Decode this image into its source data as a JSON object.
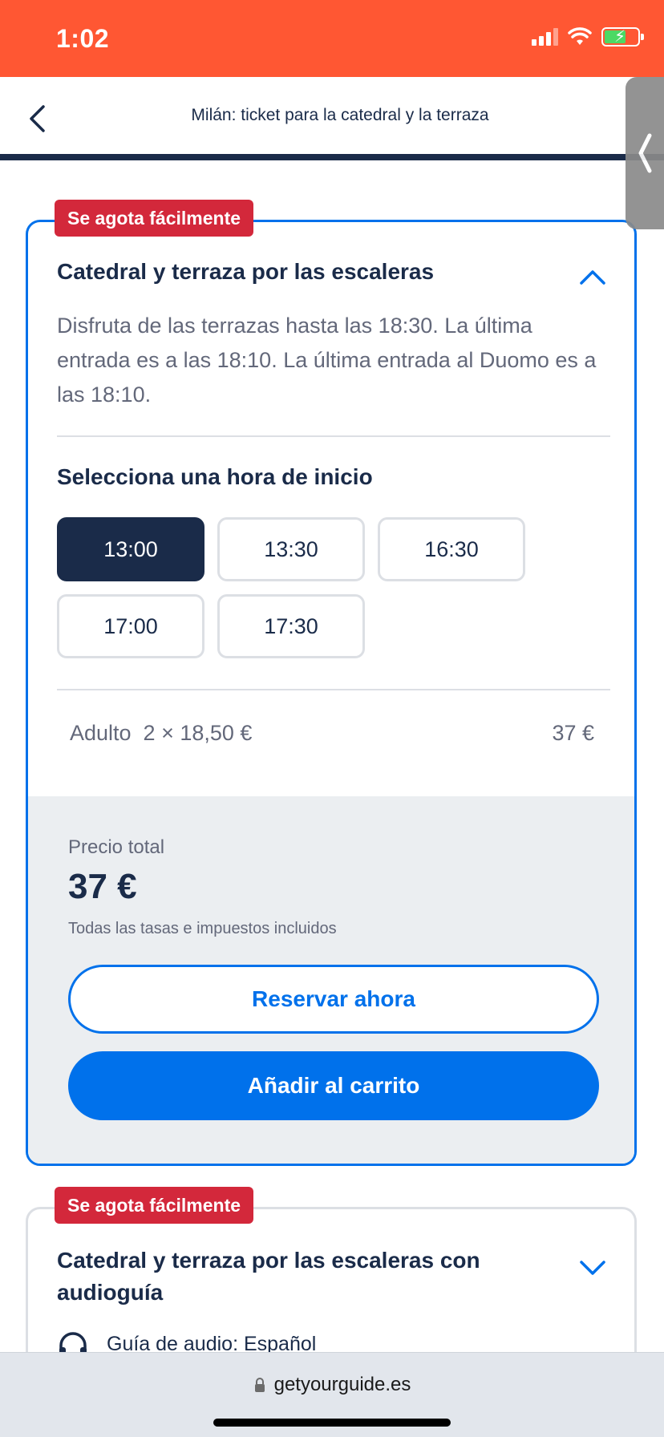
{
  "status_bar": {
    "time": "1:02"
  },
  "header": {
    "title": "Milán: ticket para la catedral y la terraza"
  },
  "options": [
    {
      "badge": "Se agota fácilmente",
      "title": "Catedral y terraza por las escaleras",
      "description": "Disfruta de las terrazas hasta las 18:30. La última entrada es a las 18:10. La última entrada al Duomo es a las 18:10.",
      "start_time_label": "Selecciona una hora de inicio",
      "times": [
        "13:00",
        "13:30",
        "16:30",
        "17:00",
        "17:30"
      ],
      "selected_time": "13:00",
      "price_line": "Adulto  2 × 18,50 €",
      "price_line_total": "37 €",
      "total_label": "Precio total",
      "total_value": "37 €",
      "taxes_note": "Todas las tasas e impuestos incluidos",
      "reserve_label": "Reservar ahora",
      "add_to_cart_label": "Añadir al carrito"
    },
    {
      "badge": "Se agota fácilmente",
      "title": "Catedral y terraza por las escaleras con audioguía",
      "audio_guide": "Guía de audio: Español"
    }
  ],
  "browser": {
    "url": "getyourguide.es"
  },
  "colors": {
    "status_bar": "#ff5733",
    "navy": "#1a2b49",
    "accent_blue": "#0071eb",
    "badge_red": "#d3283b",
    "summary_bg": "#ebeef1"
  },
  "icons": [
    "back-chevron-icon",
    "chevron-up-icon",
    "chevron-down-icon",
    "headphones-icon",
    "lock-icon",
    "signal-icon",
    "wifi-icon",
    "battery-icon"
  ]
}
